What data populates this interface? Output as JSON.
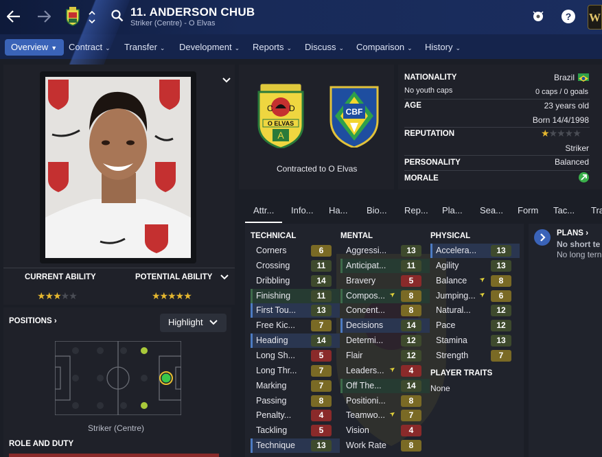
{
  "header": {
    "title": "11. ANDERSON CHUB",
    "subtitle": "Striker (Centre) - O Elvas",
    "back_icon": "arrow-left-icon",
    "forward_icon": "arrow-right-icon"
  },
  "nav": {
    "tabs": [
      {
        "label": "Overview"
      },
      {
        "label": "Contract"
      },
      {
        "label": "Transfer"
      },
      {
        "label": "Development"
      },
      {
        "label": "Reports"
      },
      {
        "label": "Discuss"
      },
      {
        "label": "Comparison"
      },
      {
        "label": "History"
      }
    ]
  },
  "ability": {
    "current_label": "CURRENT ABILITY",
    "potential_label": "POTENTIAL ABILITY",
    "current_stars": 2.5,
    "potential_stars": 4.5
  },
  "positions": {
    "label": "POSITIONS",
    "select_value": "Highlight",
    "position_text": "Striker (Centre)"
  },
  "role": {
    "label": "ROLE AND DUTY"
  },
  "club": {
    "contracted_text": "Contracted to O Elvas",
    "crest_text": "O ELVAS",
    "crest_letters": [
      "C",
      "D",
      "A"
    ],
    "nation_crest_text": "CBF"
  },
  "info": {
    "nationality_label": "NATIONALITY",
    "nationality_value": "Brazil",
    "youth_caps": "No youth caps",
    "caps_goals": "0 caps / 0 goals",
    "age_label": "AGE",
    "age_value": "23 years old",
    "born": "Born 14/4/1998",
    "reputation_label": "REPUTATION",
    "reputation_stars": 0.5,
    "role_value": "Striker",
    "personality_label": "PERSONALITY",
    "personality_value": "Balanced",
    "morale_label": "MORALE"
  },
  "subtabs": [
    "Attr...",
    "Info...",
    "Ha...",
    "Bio...",
    "Rep...",
    "Pla...",
    "Sea...",
    "Form",
    "Tac...",
    "Tra"
  ],
  "technical": {
    "label": "TECHNICAL",
    "items": [
      {
        "name": "Corners",
        "value": "6"
      },
      {
        "name": "Crossing",
        "value": "11"
      },
      {
        "name": "Dribbling",
        "value": "14"
      },
      {
        "name": "Finishing",
        "value": "11"
      },
      {
        "name": "First Tou...",
        "value": "13"
      },
      {
        "name": "Free Kic...",
        "value": "7"
      },
      {
        "name": "Heading",
        "value": "14"
      },
      {
        "name": "Long Sh...",
        "value": "5"
      },
      {
        "name": "Long Thr...",
        "value": "7"
      },
      {
        "name": "Marking",
        "value": "7"
      },
      {
        "name": "Passing",
        "value": "8"
      },
      {
        "name": "Penalty...",
        "value": "4"
      },
      {
        "name": "Tackling",
        "value": "5"
      },
      {
        "name": "Technique",
        "value": "13"
      }
    ]
  },
  "mental": {
    "label": "MENTAL",
    "items": [
      {
        "name": "Aggressi...",
        "value": "13"
      },
      {
        "name": "Anticipat...",
        "value": "11"
      },
      {
        "name": "Bravery",
        "value": "5"
      },
      {
        "name": "Compos...",
        "value": "8"
      },
      {
        "name": "Concent...",
        "value": "8"
      },
      {
        "name": "Decisions",
        "value": "14"
      },
      {
        "name": "Determi...",
        "value": "12"
      },
      {
        "name": "Flair",
        "value": "12"
      },
      {
        "name": "Leaders...",
        "value": "4"
      },
      {
        "name": "Off The...",
        "value": "14"
      },
      {
        "name": "Positioni...",
        "value": "8"
      },
      {
        "name": "Teamwo...",
        "value": "7"
      },
      {
        "name": "Vision",
        "value": "4"
      },
      {
        "name": "Work Rate",
        "value": "8"
      }
    ]
  },
  "physical": {
    "label": "PHYSICAL",
    "items": [
      {
        "name": "Accelera...",
        "value": "13"
      },
      {
        "name": "Agility",
        "value": "13"
      },
      {
        "name": "Balance",
        "value": "8"
      },
      {
        "name": "Jumping...",
        "value": "6"
      },
      {
        "name": "Natural...",
        "value": "12"
      },
      {
        "name": "Pace",
        "value": "12"
      },
      {
        "name": "Stamina",
        "value": "13"
      },
      {
        "name": "Strength",
        "value": "7"
      }
    ]
  },
  "traits": {
    "label": "PLAYER TRAITS",
    "value": "None"
  },
  "plans": {
    "label": "PLANS",
    "line1": "No short te",
    "line2": "No long tern"
  },
  "colors": {
    "accent": "#3a63b8",
    "green_hl": "#3d6b4a",
    "blue_hl": "#4d7bc2",
    "star": "#e5b72f"
  }
}
